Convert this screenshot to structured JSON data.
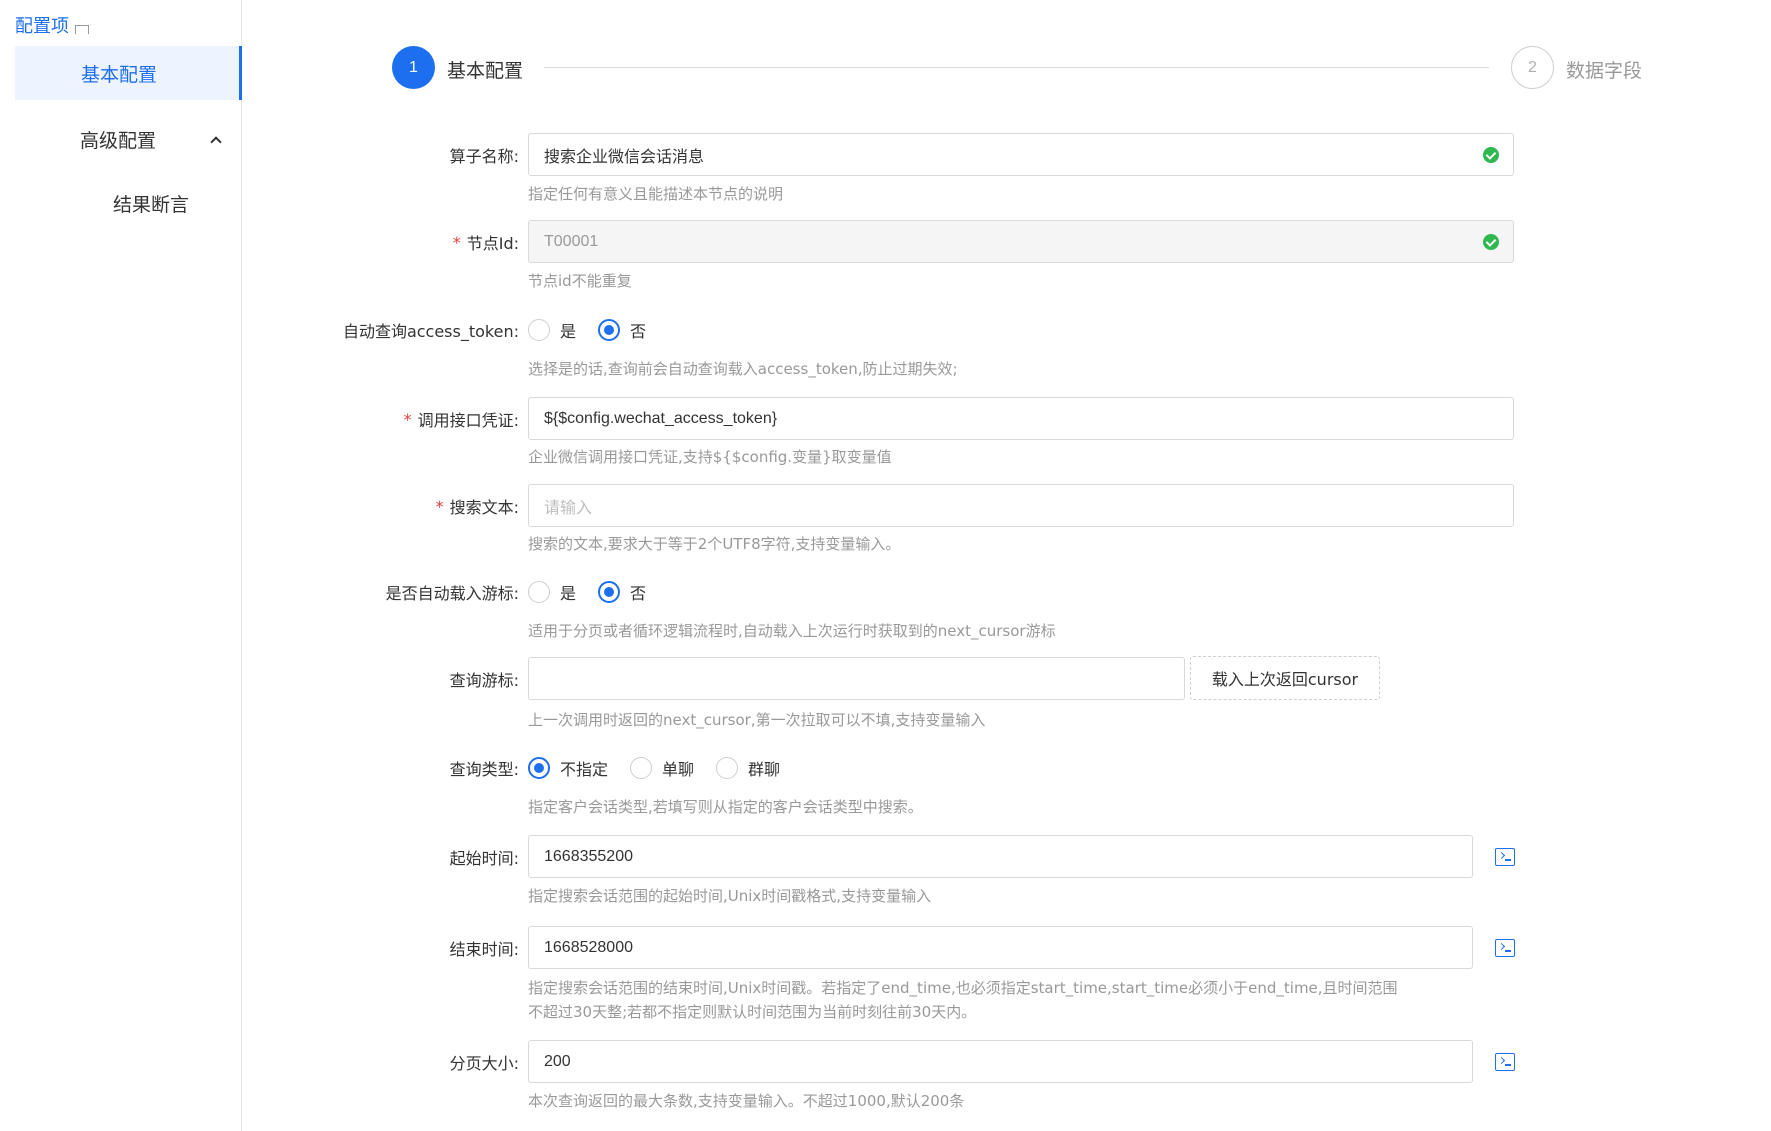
{
  "sidebar": {
    "title": "配置项",
    "items": [
      {
        "label": "基本配置"
      },
      {
        "label": "高级配置"
      },
      {
        "label": "结果断言"
      }
    ]
  },
  "steps": [
    {
      "number": "1",
      "label": "基本配置"
    },
    {
      "number": "2",
      "label": "数据字段"
    }
  ],
  "form": {
    "operator_name": {
      "label": "算子名称:",
      "value": "搜索企业微信会话消息",
      "hint": "指定任何有意义且能描述本节点的说明"
    },
    "node_id": {
      "label": "节点Id:",
      "value": "T00001",
      "hint": "节点id不能重复"
    },
    "auto_token": {
      "label": "自动查询access_token:",
      "options": [
        "是",
        "否"
      ],
      "selected": "否",
      "hint": "选择是的话,查询前会自动查询载入access_token,防止过期失效;"
    },
    "credential": {
      "label": "调用接口凭证:",
      "value": "${$config.wechat_access_token}",
      "hint": "企业微信调用接口凭证,支持${$config.变量}取变量值"
    },
    "search_text": {
      "label": "搜索文本:",
      "placeholder": "请输入",
      "hint": "搜索的文本,要求大于等于2个UTF8字符,支持变量输入。"
    },
    "auto_cursor": {
      "label": "是否自动载入游标:",
      "options": [
        "是",
        "否"
      ],
      "selected": "否",
      "hint": "适用于分页或者循环逻辑流程时,自动载入上次运行时获取到的next_cursor游标"
    },
    "cursor": {
      "label": "查询游标:",
      "value": "",
      "button": "载入上次返回cursor",
      "hint": "上一次调用时返回的next_cursor,第一次拉取可以不填,支持变量输入"
    },
    "query_type": {
      "label": "查询类型:",
      "options": [
        "不指定",
        "单聊",
        "群聊"
      ],
      "selected": "不指定",
      "hint": "指定客户会话类型,若填写则从指定的客户会话类型中搜索。"
    },
    "start_time": {
      "label": "起始时间:",
      "value": "1668355200",
      "hint": "指定搜索会话范围的起始时间,Unix时间戳格式,支持变量输入"
    },
    "end_time": {
      "label": "结束时间:",
      "value": "1668528000",
      "hint_line1": "指定搜索会话范围的结束时间,Unix时间戳。若指定了end_time,也必须指定start_time,start_time必须小于end_time,且时间范围",
      "hint_line2": "不超过30天整;若都不指定则默认时间范围为当前时刻往前30天内。"
    },
    "page_size": {
      "label": "分页大小:",
      "value": "200",
      "hint": "本次查询返回的最大条数,支持变量输入。不超过1000,默认200条"
    }
  },
  "colors": {
    "accent": "#1e6ff0",
    "success": "#2fb84f",
    "required": "#e4393c"
  },
  "icons": [
    "check-circle-icon",
    "chevron-up-icon",
    "terminal-icon"
  ]
}
